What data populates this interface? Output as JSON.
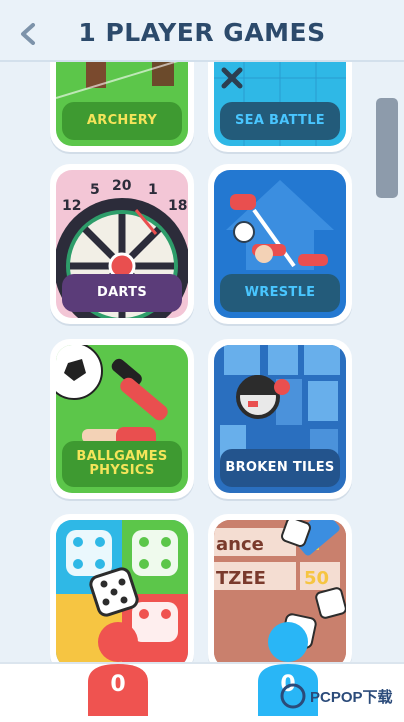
{
  "header": {
    "title": "1 PLAYER GAMES",
    "back_icon": "chevron-left-icon"
  },
  "games": [
    {
      "label": "ARCHERY",
      "bg": "#5cc64a",
      "label_color": "#f4e45a",
      "label_bg": "#3e9a31"
    },
    {
      "label": "SEA BATTLE",
      "bg": "#2fb8e6",
      "label_color": "#49c6ff",
      "label_bg": "#235b7a"
    },
    {
      "label": "DARTS",
      "bg": "#f3c6d6",
      "label_color": "#ffffff",
      "label_bg": "#5b3c79"
    },
    {
      "label": "WRESTLE",
      "bg": "#2378d1",
      "label_color": "#49c6ff",
      "label_bg": "#235b7a"
    },
    {
      "label_lines": [
        "BALLGAMES",
        "PHYSICS"
      ],
      "bg": "#5cc64a",
      "label_color": "#f4e45a",
      "label_bg": "#3e9a31"
    },
    {
      "label": "BROKEN TILES",
      "bg": "#2a6fbf",
      "label_color": "#ffffff",
      "label_bg": "#23548d"
    },
    {
      "label": "",
      "bg": "#2fb8e6"
    },
    {
      "label": "",
      "bg": "#b96a5a"
    }
  ],
  "darts_numbers": [
    "5",
    "20",
    "1",
    "12",
    "18"
  ],
  "yahtzee_texts": [
    "ance",
    "2",
    "TZEE",
    "50"
  ],
  "players": [
    {
      "count": "0",
      "color": "#ef5350"
    },
    {
      "count": "0",
      "color": "#29b6f6"
    }
  ],
  "watermark": {
    "text": "PCPOP下载"
  }
}
